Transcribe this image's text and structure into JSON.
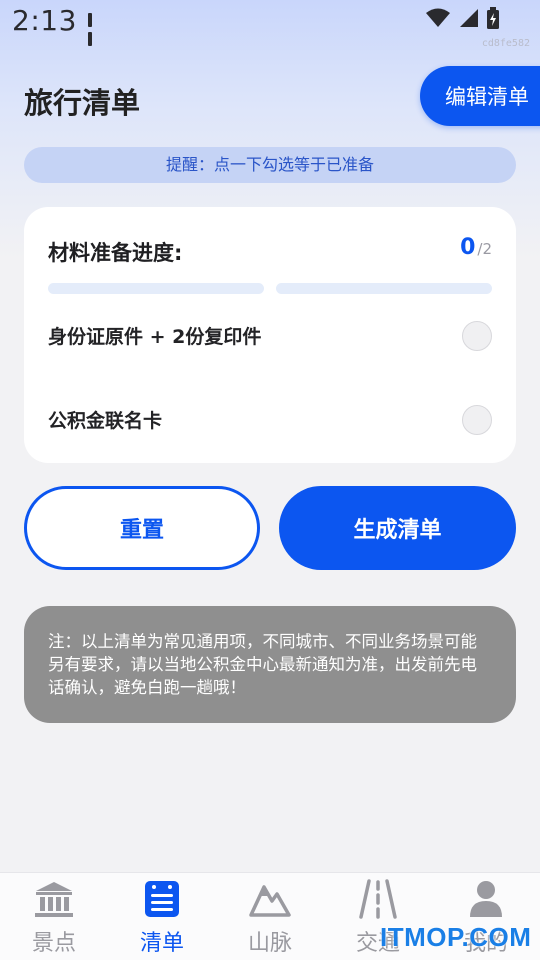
{
  "status_bar": {
    "time": "2:13",
    "device_id": "cd8fe582"
  },
  "header": {
    "title": "旅行清单",
    "edit_label": "编辑清单"
  },
  "reminder": {
    "text": "提醒：点一下勾选等于已准备"
  },
  "progress": {
    "label": "材料准备进度:",
    "done": "0",
    "total": "/2",
    "fraction": 0
  },
  "checklist": {
    "items": [
      {
        "label": "身份证原件 + 2份复印件",
        "checked": false
      },
      {
        "label": "公积金联名卡",
        "checked": false
      }
    ]
  },
  "actions": {
    "reset_label": "重置",
    "generate_label": "生成清单"
  },
  "note": {
    "text": "注：以上清单为常见通用项，不同城市、不同业务场景可能另有要求，请以当地公积金中心最新通知为准，出发前先电话确认，避免白跑一趟哦！"
  },
  "tabs": [
    {
      "label": "景点",
      "icon": "landmark-icon",
      "active": false
    },
    {
      "label": "清单",
      "icon": "list-icon",
      "active": true
    },
    {
      "label": "山脉",
      "icon": "mountain-icon",
      "active": false
    },
    {
      "label": "交通",
      "icon": "road-icon",
      "active": false
    },
    {
      "label": "我的",
      "icon": "user-icon",
      "active": false
    }
  ],
  "watermark": {
    "text": "ITMOP.COM"
  },
  "colors": {
    "accent": "#0c56f0",
    "inactive_tab": "#9a9aa0",
    "note_bg": "#8f8f8f"
  }
}
